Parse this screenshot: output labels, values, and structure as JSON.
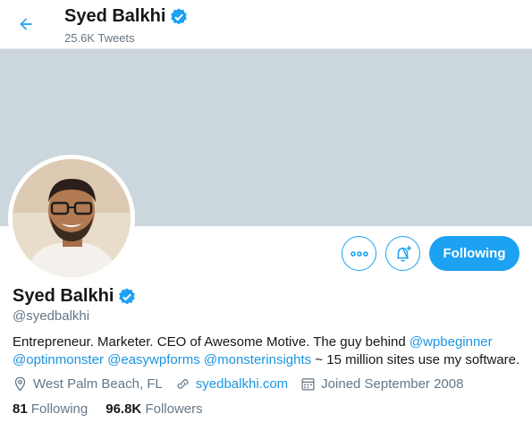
{
  "header": {
    "name": "Syed Balkhi",
    "tweets_count": "25.6K Tweets"
  },
  "actions": {
    "more_label": "•••",
    "follow_label": "Following"
  },
  "profile": {
    "name": "Syed Balkhi",
    "handle": "@syedbalkhi",
    "verified": true,
    "bio": {
      "text1": "Entrepreneur. Marketer. CEO of Awesome Motive. The guy behind ",
      "mention1": "@wpbeginner",
      "mention2": "@optinmonster",
      "mention3": "@easywpforms",
      "mention4": "@monsterinsights",
      "text2": " ~ 15 million sites use my software."
    },
    "location": "West Palm Beach, FL",
    "website": "syedbalkhi.com",
    "joined": "Joined September 2008"
  },
  "stats": {
    "following_count": "81",
    "following_label": "Following",
    "followers_count": "96.8K",
    "followers_label": "Followers"
  },
  "colors": {
    "accent": "#1da1f2",
    "link": "#1b95e0",
    "banner": "#ccd6dd",
    "muted": "#657786"
  },
  "icons": [
    "back-arrow-icon",
    "verified-badge-icon",
    "more-icon",
    "bell-plus-icon",
    "location-icon",
    "link-icon",
    "calendar-icon"
  ]
}
